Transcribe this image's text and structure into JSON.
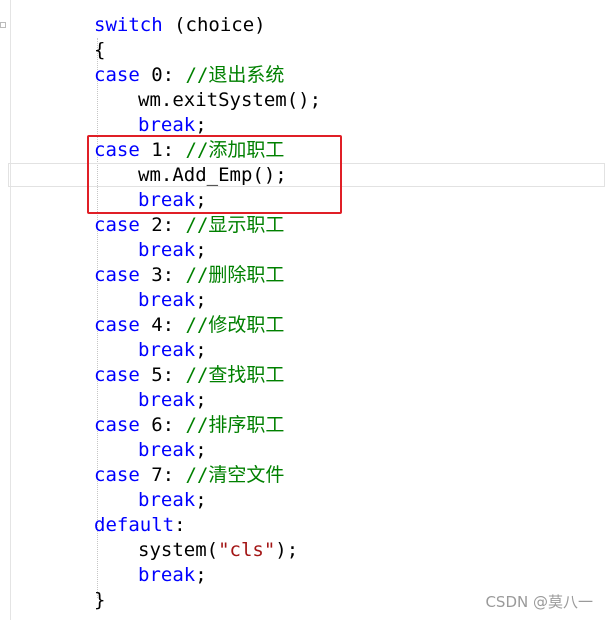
{
  "editor": {
    "lines": [
      {
        "parts": [
          {
            "t": "switch",
            "c": "kw"
          },
          {
            "t": " (choice)",
            "c": ""
          }
        ]
      },
      {
        "parts": [
          {
            "t": "{",
            "c": ""
          }
        ]
      },
      {
        "parts": [
          {
            "t": "case",
            "c": "kw"
          },
          {
            "t": " 0: ",
            "c": ""
          },
          {
            "t": "//退出系统",
            "c": "cm"
          }
        ]
      },
      {
        "parts": [
          {
            "t": "wm.exitSystem();",
            "c": ""
          }
        ]
      },
      {
        "parts": [
          {
            "t": "break",
            "c": "kw"
          },
          {
            "t": ";",
            "c": ""
          }
        ]
      },
      {
        "parts": [
          {
            "t": "case",
            "c": "kw"
          },
          {
            "t": " 1: ",
            "c": ""
          },
          {
            "t": "//添加职工",
            "c": "cm"
          }
        ]
      },
      {
        "parts": [
          {
            "t": "wm.Add_Emp();",
            "c": ""
          }
        ]
      },
      {
        "parts": [
          {
            "t": "break",
            "c": "kw"
          },
          {
            "t": ";",
            "c": ""
          }
        ]
      },
      {
        "parts": [
          {
            "t": "case",
            "c": "kw"
          },
          {
            "t": " 2: ",
            "c": ""
          },
          {
            "t": "//显示职工",
            "c": "cm"
          }
        ]
      },
      {
        "parts": [
          {
            "t": "break",
            "c": "kw"
          },
          {
            "t": ";",
            "c": ""
          }
        ]
      },
      {
        "parts": [
          {
            "t": "case",
            "c": "kw"
          },
          {
            "t": " 3: ",
            "c": ""
          },
          {
            "t": "//删除职工",
            "c": "cm"
          }
        ]
      },
      {
        "parts": [
          {
            "t": "break",
            "c": "kw"
          },
          {
            "t": ";",
            "c": ""
          }
        ]
      },
      {
        "parts": [
          {
            "t": "case",
            "c": "kw"
          },
          {
            "t": " 4: ",
            "c": ""
          },
          {
            "t": "//修改职工",
            "c": "cm"
          }
        ]
      },
      {
        "parts": [
          {
            "t": "break",
            "c": "kw"
          },
          {
            "t": ";",
            "c": ""
          }
        ]
      },
      {
        "parts": [
          {
            "t": "case",
            "c": "kw"
          },
          {
            "t": " 5: ",
            "c": ""
          },
          {
            "t": "//查找职工",
            "c": "cm"
          }
        ]
      },
      {
        "parts": [
          {
            "t": "break",
            "c": "kw"
          },
          {
            "t": ";",
            "c": ""
          }
        ]
      },
      {
        "parts": [
          {
            "t": "case",
            "c": "kw"
          },
          {
            "t": " 6: ",
            "c": ""
          },
          {
            "t": "//排序职工",
            "c": "cm"
          }
        ]
      },
      {
        "parts": [
          {
            "t": "break",
            "c": "kw"
          },
          {
            "t": ";",
            "c": ""
          }
        ]
      },
      {
        "parts": [
          {
            "t": "case",
            "c": "kw"
          },
          {
            "t": " 7: ",
            "c": ""
          },
          {
            "t": "//清空文件",
            "c": "cm"
          }
        ]
      },
      {
        "parts": [
          {
            "t": "break",
            "c": "kw"
          },
          {
            "t": ";",
            "c": ""
          }
        ]
      },
      {
        "parts": [
          {
            "t": "default",
            "c": "kw"
          },
          {
            "t": ":",
            "c": ""
          }
        ]
      },
      {
        "parts": [
          {
            "t": "system(",
            "c": ""
          },
          {
            "t": "\"cls\"",
            "c": "str"
          },
          {
            "t": ");",
            "c": ""
          }
        ]
      },
      {
        "parts": [
          {
            "t": "break",
            "c": "kw"
          },
          {
            "t": ";",
            "c": ""
          }
        ]
      },
      {
        "parts": [
          {
            "t": "}",
            "c": ""
          }
        ]
      }
    ]
  },
  "colors": {
    "keyword": "#0000ff",
    "comment": "#008000",
    "string": "#a31515",
    "highlight_border": "#e01f26"
  },
  "watermark": "CSDN @莫八一"
}
